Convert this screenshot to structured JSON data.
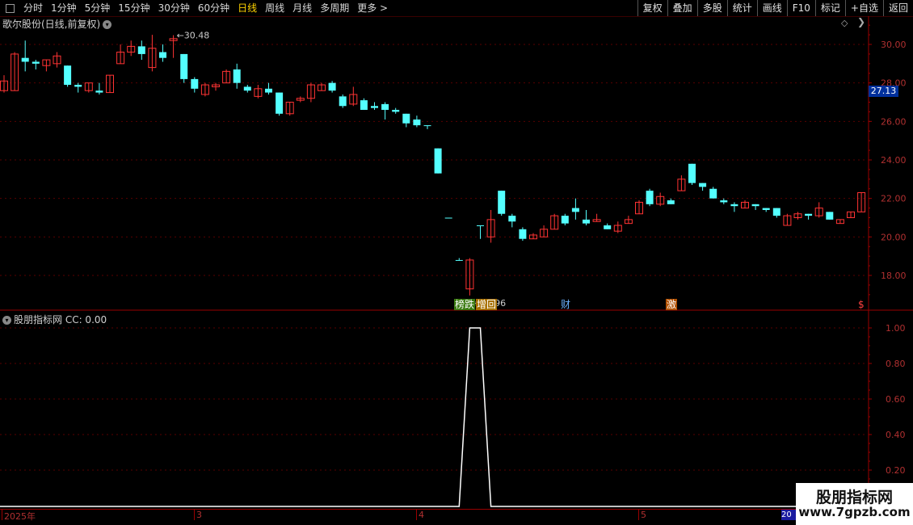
{
  "toolbar": {
    "periods": [
      "分时",
      "1分钟",
      "5分钟",
      "15分钟",
      "30分钟",
      "60分钟",
      "日线",
      "周线",
      "月线",
      "多周期",
      "更多 >"
    ],
    "active_index": 6,
    "actions": [
      "复权",
      "叠加",
      "多股",
      "统计",
      "画线",
      "F10",
      "标记",
      "+自选",
      "返回"
    ]
  },
  "stock": {
    "title": "歌尔股份(日线,前复权)",
    "high_label": "30.48",
    "low_label": "16.96",
    "current_price": "27.13"
  },
  "price_axis": {
    "labels": [
      "30.00",
      "28.00",
      "26.00",
      "24.00",
      "22.00",
      "20.00",
      "18.00"
    ]
  },
  "indicator": {
    "title": "股朋指标网 CC: 0.00",
    "axis_labels": [
      "1.00",
      "0.80",
      "0.60",
      "0.40",
      "0.20"
    ]
  },
  "tags": [
    {
      "text": "榜跌",
      "color": "#ffffff",
      "bg": "#3a7a10"
    },
    {
      "text": "增回",
      "color": "#ffffff",
      "bg": "#a87000"
    },
    {
      "text": "财",
      "color": "#6ab0ff",
      "bg": "transparent"
    },
    {
      "text": "激",
      "color": "#ffffff",
      "bg": "#b05000"
    },
    {
      "text": "$",
      "color": "#ff4040",
      "bg": "transparent"
    }
  ],
  "dates": [
    "2025年",
    "3",
    "4",
    "5",
    "20"
  ],
  "watermark": {
    "line1": "股朋指标网",
    "line2": "www.7gpzb.com"
  },
  "colors": {
    "up": "#ff3333",
    "down": "#54ffff",
    "grid": "#5a0000",
    "axis": "#9a0000"
  },
  "chart_data": {
    "type": "candlestick",
    "price_range": [
      16.0,
      31.0
    ],
    "candles": [
      [
        27.6,
        28.1,
        27.5,
        28.4
      ],
      [
        27.6,
        29.5,
        27.6,
        29.6
      ],
      [
        29.3,
        29.1,
        28.6,
        30.2
      ],
      [
        29.1,
        29.0,
        28.7,
        29.2
      ],
      [
        28.9,
        29.2,
        28.6,
        29.2
      ],
      [
        29.0,
        29.4,
        28.8,
        29.6
      ],
      [
        28.9,
        27.9,
        27.8,
        28.9
      ],
      [
        27.9,
        27.8,
        27.5,
        28.0
      ],
      [
        27.6,
        28.0,
        27.5,
        28.0
      ],
      [
        27.6,
        27.5,
        27.4,
        28.0
      ],
      [
        27.5,
        28.4,
        27.5,
        28.4
      ],
      [
        29.0,
        29.6,
        29.0,
        30.0
      ],
      [
        29.6,
        29.9,
        29.4,
        30.2
      ],
      [
        29.9,
        29.5,
        29.2,
        30.2
      ],
      [
        28.8,
        29.8,
        28.6,
        30.5
      ],
      [
        29.6,
        29.3,
        29.1,
        30.0
      ],
      [
        30.2,
        30.3,
        29.3,
        30.48
      ],
      [
        29.5,
        28.2,
        28.0,
        29.5
      ],
      [
        28.2,
        27.7,
        27.5,
        28.3
      ],
      [
        27.4,
        27.9,
        27.3,
        28.0
      ],
      [
        27.8,
        27.9,
        27.6,
        28.0
      ],
      [
        28.0,
        28.6,
        28.0,
        28.7
      ],
      [
        28.7,
        28.0,
        27.7,
        29.0
      ],
      [
        27.8,
        27.6,
        27.5,
        27.9
      ],
      [
        27.3,
        27.7,
        27.2,
        27.9
      ],
      [
        27.7,
        27.5,
        27.4,
        28.0
      ],
      [
        27.5,
        26.4,
        26.3,
        27.5
      ],
      [
        26.4,
        27.0,
        26.3,
        27.0
      ],
      [
        27.1,
        27.2,
        27.0,
        27.3
      ],
      [
        27.2,
        27.9,
        27.0,
        28.0
      ],
      [
        27.6,
        27.9,
        27.6,
        28.0
      ],
      [
        28.0,
        27.6,
        27.5,
        28.1
      ],
      [
        27.3,
        26.8,
        26.7,
        27.4
      ],
      [
        26.9,
        27.4,
        26.8,
        27.8
      ],
      [
        27.1,
        26.6,
        26.6,
        27.2
      ],
      [
        26.8,
        26.7,
        26.6,
        27.0
      ],
      [
        26.9,
        26.6,
        26.1,
        27.0
      ],
      [
        26.6,
        26.5,
        26.4,
        26.7
      ],
      [
        26.4,
        25.9,
        25.7,
        26.4
      ],
      [
        26.1,
        25.8,
        25.7,
        26.3
      ],
      [
        25.8,
        25.8,
        25.6,
        25.8
      ],
      [
        24.6,
        23.3,
        23.3,
        24.6
      ],
      [
        21.0,
        21.0,
        21.0,
        21.0
      ],
      [
        18.8,
        18.8,
        18.8,
        18.9
      ],
      [
        17.3,
        18.8,
        16.96,
        18.9
      ],
      [
        20.6,
        20.6,
        19.9,
        20.6
      ],
      [
        20.0,
        20.9,
        19.7,
        21.4
      ],
      [
        22.4,
        21.2,
        21.1,
        22.4
      ],
      [
        21.1,
        20.8,
        20.5,
        21.2
      ],
      [
        20.4,
        19.9,
        19.8,
        20.5
      ],
      [
        19.9,
        20.1,
        19.9,
        20.2
      ],
      [
        20.0,
        20.4,
        20.0,
        20.6
      ],
      [
        20.4,
        21.1,
        20.4,
        21.2
      ],
      [
        21.1,
        20.7,
        20.6,
        21.2
      ],
      [
        21.5,
        21.3,
        20.9,
        22.0
      ],
      [
        20.9,
        20.7,
        20.6,
        21.4
      ],
      [
        20.8,
        20.9,
        20.8,
        21.2
      ],
      [
        20.6,
        20.4,
        20.4,
        20.7
      ],
      [
        20.3,
        20.6,
        20.2,
        20.8
      ],
      [
        20.7,
        20.9,
        20.7,
        21.1
      ],
      [
        21.2,
        21.8,
        21.2,
        21.9
      ],
      [
        22.4,
        21.7,
        21.6,
        22.5
      ],
      [
        21.7,
        22.1,
        21.6,
        22.3
      ],
      [
        21.9,
        21.7,
        21.7,
        22.0
      ],
      [
        22.4,
        23.0,
        22.4,
        23.2
      ],
      [
        23.8,
        22.8,
        22.7,
        23.8
      ],
      [
        22.8,
        22.6,
        22.4,
        22.8
      ],
      [
        22.5,
        22.0,
        22.0,
        22.6
      ],
      [
        21.9,
        21.8,
        21.7,
        22.0
      ],
      [
        21.7,
        21.6,
        21.3,
        21.8
      ],
      [
        21.5,
        21.8,
        21.5,
        21.9
      ],
      [
        21.7,
        21.6,
        21.4,
        21.7
      ],
      [
        21.5,
        21.4,
        21.3,
        21.5
      ],
      [
        21.5,
        21.1,
        21.0,
        21.5
      ],
      [
        20.6,
        21.1,
        20.6,
        21.2
      ],
      [
        21.0,
        21.2,
        20.9,
        21.3
      ],
      [
        21.2,
        21.1,
        20.9,
        21.2
      ],
      [
        21.1,
        21.5,
        21.0,
        21.8
      ],
      [
        21.3,
        20.9,
        20.9,
        21.3
      ],
      [
        20.7,
        20.9,
        20.7,
        20.9
      ],
      [
        21.0,
        21.3,
        21.0,
        21.3
      ],
      [
        21.3,
        22.3,
        21.3,
        22.3
      ]
    ],
    "indicator_series": {
      "name": "CC",
      "range": [
        0.1,
        1.1
      ],
      "values_by_index": {
        "44": 1.0,
        "45": 1.0
      }
    }
  }
}
